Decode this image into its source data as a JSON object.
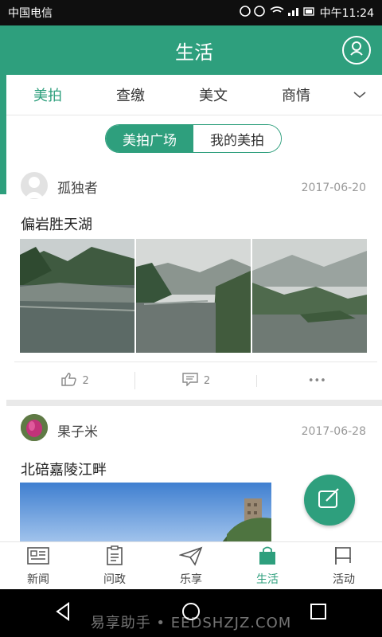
{
  "status_bar": {
    "carrier": "中国电信",
    "time": "中午11:24",
    "icons": [
      "headset-icon",
      "alarm-icon",
      "wifi-icon",
      "signal-icon",
      "battery-icon"
    ]
  },
  "header": {
    "title": "生活",
    "profile_icon": "user-icon"
  },
  "tabs": [
    {
      "label": "美拍",
      "active": true
    },
    {
      "label": "查缴",
      "active": false
    },
    {
      "label": "美文",
      "active": false
    },
    {
      "label": "商情",
      "active": false
    }
  ],
  "segment": {
    "active": "美拍广场",
    "inactive": "我的美拍"
  },
  "posts": [
    {
      "username": "孤独者",
      "date": "2017-06-20",
      "title": "偏岩胜天湖",
      "likes": "2",
      "comments": "2",
      "more": "•••"
    },
    {
      "username": "果子米",
      "date": "2017-06-28",
      "title": "北碚嘉陵江畔"
    }
  ],
  "bottom_nav": [
    {
      "label": "新闻",
      "icon": "newspaper-icon",
      "active": false
    },
    {
      "label": "问政",
      "icon": "clipboard-icon",
      "active": false
    },
    {
      "label": "乐享",
      "icon": "paper-plane-icon",
      "active": false
    },
    {
      "label": "生活",
      "icon": "shopping-bag-icon",
      "active": true
    },
    {
      "label": "活动",
      "icon": "flag-icon",
      "active": false
    }
  ],
  "watermark": "易享助手 • EEDSHZJZ.COM",
  "colors": {
    "accent": "#2e9f7d",
    "status_bar": "#0f0f0f",
    "system_bar": "#000000"
  }
}
